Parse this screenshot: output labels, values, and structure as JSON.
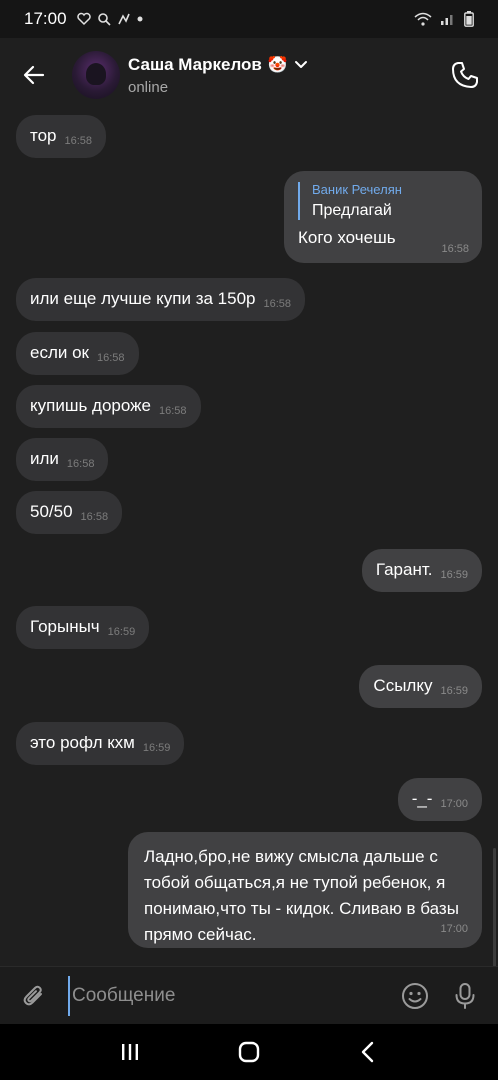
{
  "statusbar": {
    "time": "17:00"
  },
  "header": {
    "name": "Саша Маркелов",
    "emoji": "🤡",
    "status": "online"
  },
  "messages": [
    {
      "text": "тор",
      "time": "16:58"
    },
    {
      "quote_name": "Ваник Речелян",
      "quote_text": "Предлагай",
      "text": "Кого хочешь",
      "time": "16:58"
    },
    {
      "text": "или еще лучше купи за 150р",
      "time": "16:58"
    },
    {
      "text": "если ок",
      "time": "16:58"
    },
    {
      "text": "купишь дороже",
      "time": "16:58"
    },
    {
      "text": "или",
      "time": "16:58"
    },
    {
      "text": "50/50",
      "time": "16:58"
    },
    {
      "text": "Гарант.",
      "time": "16:59"
    },
    {
      "text": "Горыныч",
      "time": "16:59"
    },
    {
      "text": "Ссылку",
      "time": "16:59"
    },
    {
      "text": "это рофл кхм",
      "time": "16:59"
    },
    {
      "text": "-_-",
      "time": "17:00"
    },
    {
      "text": "Ладно,бро,не вижу смысла дальше с тобой общаться,я не тупой ребенок, я понимаю,что ты - кидок. Сливаю в базы прямо сейчас.",
      "time": "17:00"
    }
  ],
  "composer": {
    "placeholder": "Сообщение",
    "value": ""
  },
  "colors": {
    "accent": "#71aaeb",
    "incoming": "#333335",
    "outgoing": "#414143",
    "background": "#1f1f1f"
  },
  "icons": [
    "back-arrow-icon",
    "chevron-down-icon",
    "phone-icon",
    "attach-icon",
    "sticker-icon",
    "mic-icon",
    "recent-apps-icon",
    "home-icon",
    "back-icon"
  ]
}
